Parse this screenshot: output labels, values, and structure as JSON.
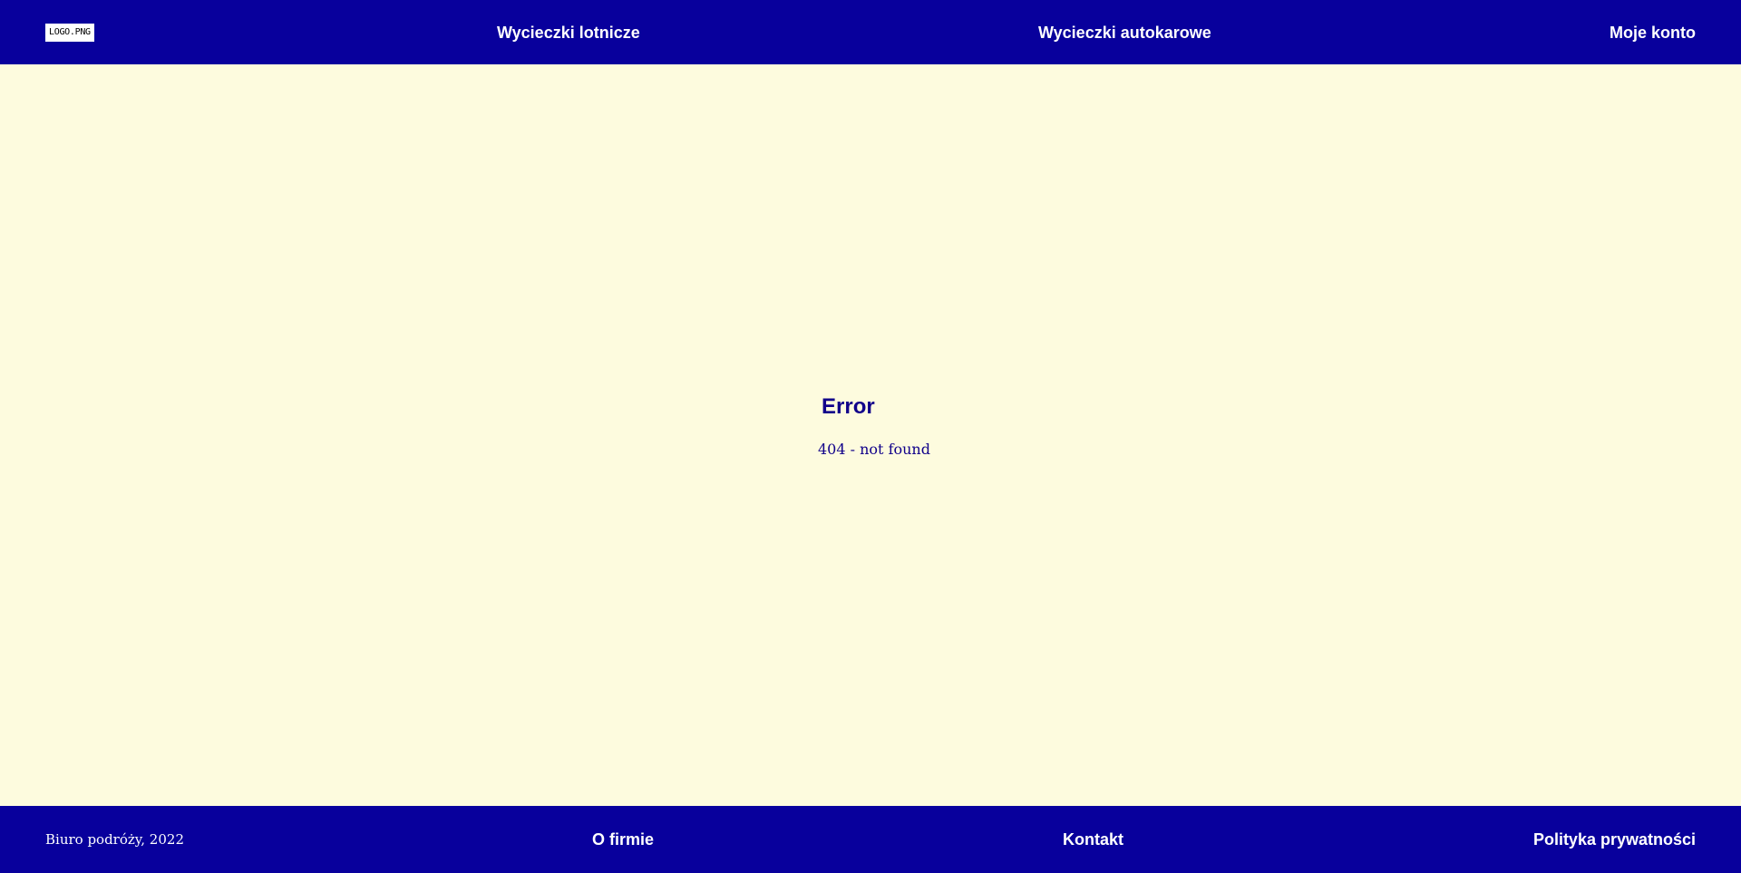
{
  "header": {
    "logo_text": "LOGO.PNG",
    "nav": {
      "air_trips": "Wycieczki lotnicze",
      "bus_trips": "Wycieczki autokarowe",
      "account": "Moje konto"
    }
  },
  "main": {
    "error_title": "Error",
    "error_message": "404 - not found"
  },
  "footer": {
    "copyright": "Biuro podróży, 2022",
    "links": {
      "about": "O firmie",
      "contact": "Kontakt",
      "privacy": "Polityka prywatności"
    }
  },
  "colors": {
    "header_bg": "#08009c",
    "page_bg": "#fdfbde",
    "text_accent": "#10008a",
    "link_text": "#ffffff"
  }
}
